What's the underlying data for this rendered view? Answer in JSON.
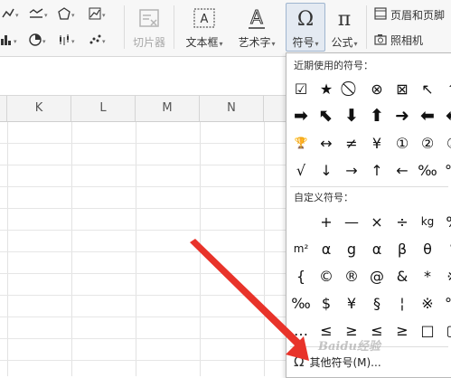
{
  "toolbar": {
    "cut_picture_label": "切片器",
    "textbox_label": "文本框",
    "wordart_label": "艺术字",
    "symbol_label": "符号",
    "formula_label": "公式",
    "header_footer_label": "页眉和页脚",
    "camera_label": "照相机"
  },
  "columns": [
    "K",
    "L",
    "M",
    "N"
  ],
  "symbol_menu": {
    "recent_title": "近期使用的符号：",
    "recent_symbols": [
      "☑",
      "★",
      "⃠",
      "⊗",
      "⊠",
      "↖",
      "⬆",
      "➡",
      "⬉",
      "⬇",
      "⬆",
      "➜",
      "⬅",
      "⬅",
      "🏆",
      "↔",
      "≠",
      "¥",
      "①",
      "②",
      "③",
      "√",
      "↓",
      "→",
      "↑",
      "←",
      "‰",
      "℃"
    ],
    "custom_title": "自定义符号：",
    "custom_symbols": [
      "",
      "+",
      "—",
      "×",
      "÷",
      "kg",
      "%",
      "m²",
      "α",
      "g",
      "α",
      "β",
      "θ",
      "°",
      "{",
      "©",
      "®",
      "@",
      "&",
      "*",
      "※",
      "‰",
      "$",
      "¥",
      "§",
      "¦",
      "※",
      "℃",
      "…",
      "≤",
      "≥",
      "≤",
      "≥",
      "□",
      "▢"
    ],
    "more_label": "其他符号(M)...",
    "more_icon": "omega-icon"
  },
  "watermark": "Baidu经验",
  "colors": {
    "arrow": "#e8332a",
    "active_button": "#e4eaf2"
  }
}
